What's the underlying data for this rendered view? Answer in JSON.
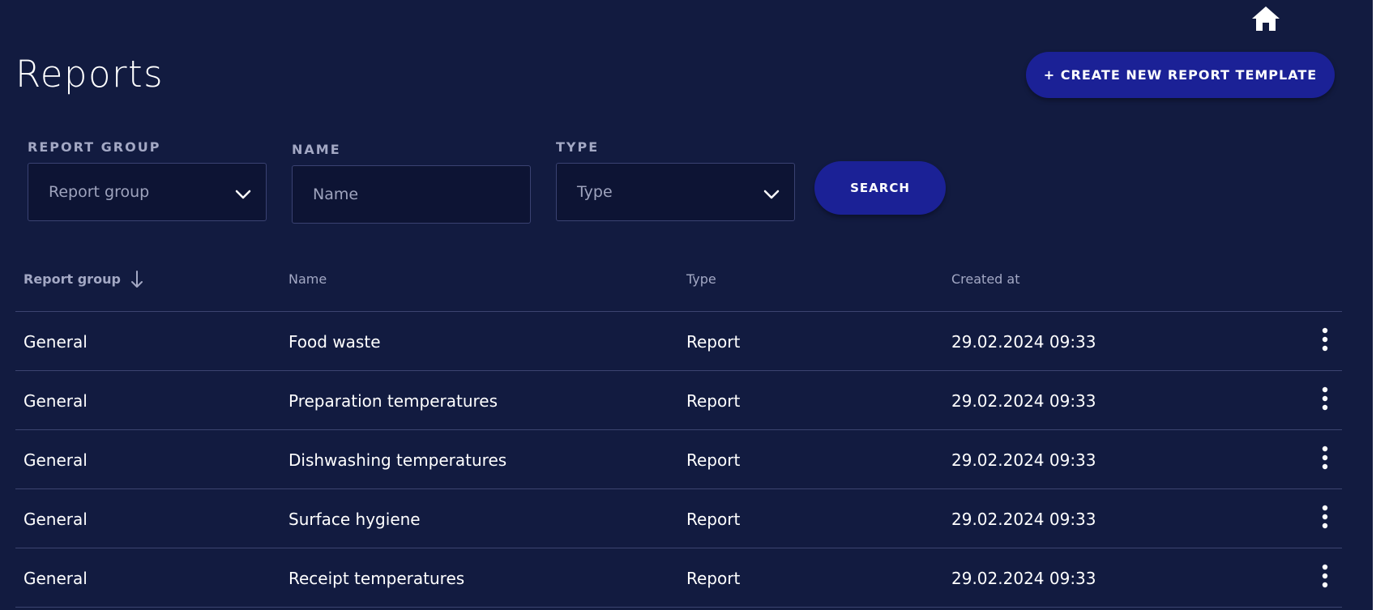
{
  "header": {
    "title": "Reports",
    "home_icon": "home-icon",
    "create_button_label": "+ CREATE NEW REPORT TEMPLATE"
  },
  "filters": {
    "report_group": {
      "label": "REPORT GROUP",
      "placeholder": "Report group",
      "icon": "chevron-down-icon"
    },
    "name": {
      "label": "NAME",
      "placeholder": "Name"
    },
    "type": {
      "label": "TYPE",
      "placeholder": "Type",
      "icon": "chevron-down-icon"
    },
    "search_label": "SEARCH"
  },
  "table": {
    "columns": {
      "report_group": "Report group",
      "name": "Name",
      "type": "Type",
      "created_at": "Created at"
    },
    "sort_icon": "arrow-down-icon",
    "row_actions_icon": "kebab-menu-icon",
    "rows": [
      {
        "report_group": "General",
        "name": "Food waste",
        "type": "Report",
        "created_at": "29.02.2024 09:33"
      },
      {
        "report_group": "General",
        "name": "Preparation temperatures",
        "type": "Report",
        "created_at": "29.02.2024 09:33"
      },
      {
        "report_group": "General",
        "name": "Dishwashing temperatures",
        "type": "Report",
        "created_at": "29.02.2024 09:33"
      },
      {
        "report_group": "General",
        "name": "Surface hygiene",
        "type": "Report",
        "created_at": "29.02.2024 09:33"
      },
      {
        "report_group": "General",
        "name": "Receipt temperatures",
        "type": "Report",
        "created_at": "29.02.2024 09:33"
      }
    ]
  },
  "colors": {
    "background": "#121b40",
    "accent": "#1b2196",
    "input_background": "#0d1434",
    "muted_text": "#a3a8c4",
    "divider": "#3c4470"
  }
}
